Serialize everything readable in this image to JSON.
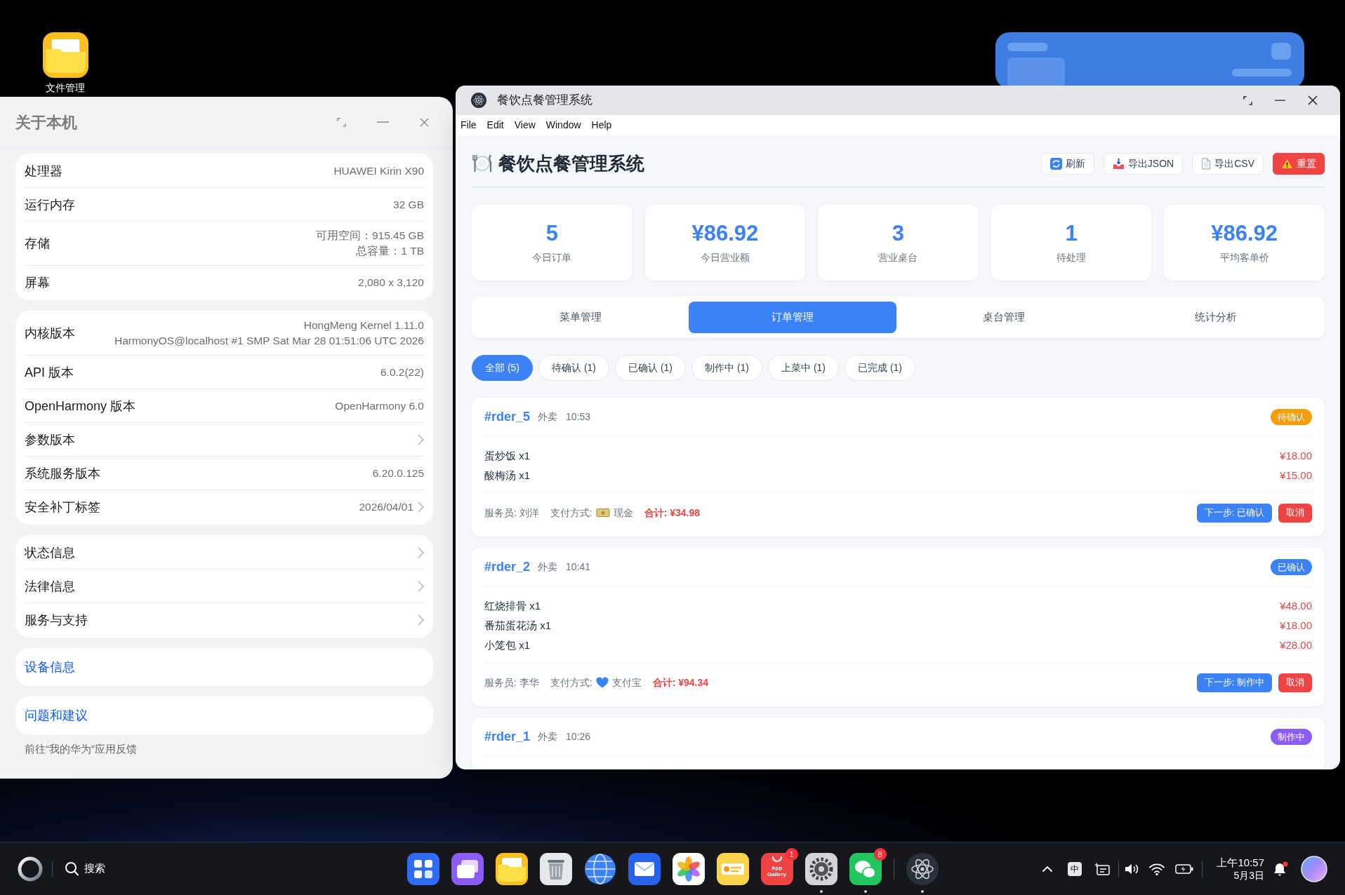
{
  "desktop": {
    "shortcuts": [
      {
        "label": "文件管理"
      }
    ]
  },
  "about_window": {
    "title": "关于本机",
    "groups": [
      {
        "kind": "list",
        "rows": [
          {
            "label": "处理器",
            "values": [
              "HUAWEI Kirin X90"
            ],
            "chevron": false
          },
          {
            "label": "运行内存",
            "values": [
              "32 GB"
            ],
            "chevron": false
          },
          {
            "label": "存储",
            "values": [
              "可用空间：915.45 GB",
              "总容量：1 TB"
            ],
            "chevron": false
          },
          {
            "label": "屏幕",
            "values": [
              "2,080 x 3,120"
            ],
            "chevron": false
          }
        ]
      },
      {
        "kind": "list",
        "rows": [
          {
            "label": "内核版本",
            "values": [
              "HongMeng Kernel 1.11.0",
              "HarmonyOS@localhost #1 SMP Sat Mar 28 01:51:06 UTC 2026"
            ],
            "chevron": false
          },
          {
            "label": "API 版本",
            "values": [
              "6.0.2(22)"
            ],
            "chevron": false
          },
          {
            "label": "OpenHarmony 版本",
            "values": [
              "OpenHarmony 6.0"
            ],
            "chevron": false
          },
          {
            "label": "参数版本",
            "chevron": true
          },
          {
            "label": "系统服务版本",
            "values": [
              "6.20.0.125"
            ],
            "chevron": false
          },
          {
            "label": "安全补丁标签",
            "values": [
              "2026/04/01"
            ],
            "chevron": true
          }
        ]
      },
      {
        "kind": "list",
        "rows": [
          {
            "label": "状态信息",
            "chevron": true
          },
          {
            "label": "法律信息",
            "chevron": true
          },
          {
            "label": "服务与支持",
            "chevron": true
          }
        ]
      },
      {
        "kind": "link",
        "label": "设备信息"
      },
      {
        "kind": "link",
        "label": "问题和建议"
      }
    ],
    "note": "前往“我的华为”应用反馈"
  },
  "app_window": {
    "title": "餐饮点餐管理系统",
    "menu": [
      "File",
      "Edit",
      "View",
      "Window",
      "Help"
    ],
    "heading": "餐饮点餐管理系统",
    "actions": [
      {
        "label": "刷新",
        "kind": "refresh"
      },
      {
        "label": "导出JSON",
        "kind": "download"
      },
      {
        "label": "导出CSV",
        "kind": "document"
      },
      {
        "label": "重置",
        "kind": "danger"
      }
    ],
    "stats": [
      {
        "value": "5",
        "label": "今日订单"
      },
      {
        "value": "¥86.92",
        "label": "今日营业额"
      },
      {
        "value": "3",
        "label": "营业桌台"
      },
      {
        "value": "1",
        "label": "待处理"
      },
      {
        "value": "¥86.92",
        "label": "平均客单价"
      }
    ],
    "tabs": [
      {
        "label": "菜单管理",
        "selected": false
      },
      {
        "label": "订单管理",
        "selected": true
      },
      {
        "label": "桌台管理",
        "selected": false
      },
      {
        "label": "统计分析",
        "selected": false
      }
    ],
    "filters": [
      {
        "label": "全部 (5)",
        "selected": true
      },
      {
        "label": "待确认 (1)",
        "selected": false
      },
      {
        "label": "已确认 (1)",
        "selected": false
      },
      {
        "label": "制作中 (1)",
        "selected": false
      },
      {
        "label": "上菜中 (1)",
        "selected": false
      },
      {
        "label": "已完成 (1)",
        "selected": false
      }
    ],
    "orders": [
      {
        "id": "#rder_5",
        "type": "外卖",
        "time": "10:53",
        "status": "待确认",
        "color": "#f59e0b",
        "items": [
          {
            "name": "蛋炒饭 x1",
            "price": "¥18.00"
          },
          {
            "name": "酸梅汤 x1",
            "price": "¥15.00"
          }
        ],
        "waiter": "服务员: 刘洋",
        "payment_label": "支付方式:",
        "payment": {
          "kind": "cash",
          "text": "现金"
        },
        "total": "合计: ¥34.98",
        "buttons": [
          {
            "label": "下一步: 已确认",
            "kind": "primary"
          },
          {
            "label": "取消",
            "kind": "danger"
          }
        ]
      },
      {
        "id": "#rder_2",
        "type": "外卖",
        "time": "10:41",
        "status": "已确认",
        "color": "#3b82f6",
        "items": [
          {
            "name": "红烧排骨 x1",
            "price": "¥48.00"
          },
          {
            "name": "番茄蛋花汤 x1",
            "price": "¥18.00"
          },
          {
            "name": "小笼包 x1",
            "price": "¥28.00"
          }
        ],
        "waiter": "服务员: 李华",
        "payment_label": "支付方式:",
        "payment": {
          "kind": "alipay",
          "text": "支付宝"
        },
        "total": "合计: ¥94.34",
        "buttons": [
          {
            "label": "下一步: 制作中",
            "kind": "primary"
          },
          {
            "label": "取消",
            "kind": "danger"
          }
        ]
      },
      {
        "id": "#rder_1",
        "type": "外卖",
        "time": "10:26",
        "status": "制作中",
        "color": "#8b5cf6"
      }
    ]
  },
  "taskbar": {
    "search": "搜索",
    "apps": [
      {
        "kind": "launcher",
        "running": false
      },
      {
        "kind": "multitask",
        "running": false
      },
      {
        "kind": "files",
        "running": false
      },
      {
        "kind": "trash",
        "running": false
      },
      {
        "kind": "browser",
        "running": false
      },
      {
        "kind": "mail",
        "running": false
      },
      {
        "kind": "gallery",
        "running": false
      },
      {
        "kind": "notes",
        "running": false
      },
      {
        "kind": "store",
        "label": "App Gallery",
        "badge": "1",
        "running": false
      },
      {
        "kind": "settings",
        "running": true
      },
      {
        "kind": "chat",
        "badge": "8",
        "running": true
      }
    ],
    "open_apps": [
      {
        "kind": "atom",
        "running": true
      }
    ],
    "tray": {
      "input_method": "中",
      "time": "上午10:57",
      "date": "5月3日",
      "unread": true
    }
  }
}
